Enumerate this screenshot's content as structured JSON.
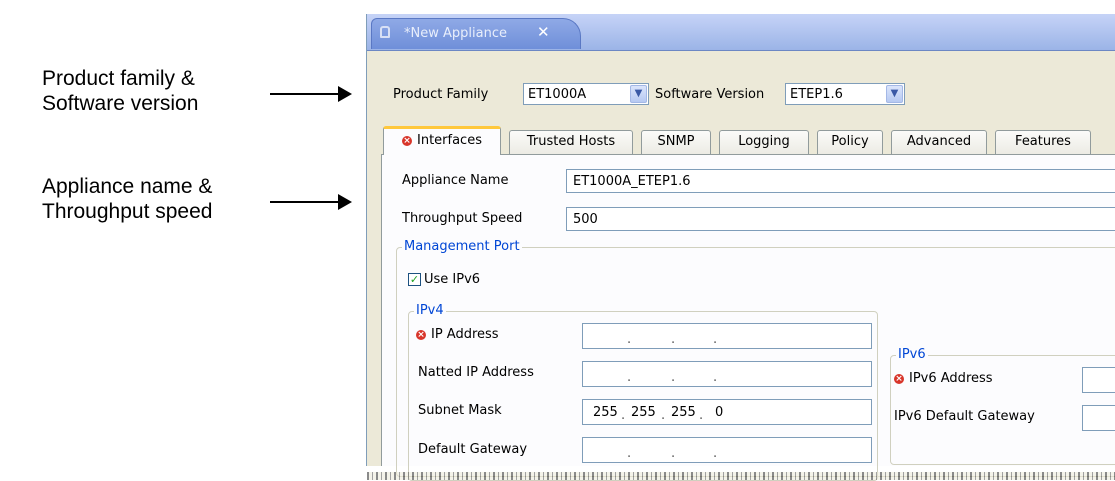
{
  "annotations": {
    "product_family_line1": "Product family &",
    "product_family_line2": "Software version",
    "appliance_line1": "Appliance name &",
    "appliance_line2": "Throughput speed"
  },
  "editor_tab": {
    "title": "*New Appliance",
    "close": "✕"
  },
  "header": {
    "product_family_label": "Product Family",
    "product_family_value": "ET1000A",
    "software_version_label": "Software Version",
    "software_version_value": "ETEP1.6"
  },
  "tabs": [
    {
      "label": "Interfaces",
      "error": true
    },
    {
      "label": "Trusted Hosts"
    },
    {
      "label": "SNMP"
    },
    {
      "label": "Logging"
    },
    {
      "label": "Policy"
    },
    {
      "label": "Advanced"
    },
    {
      "label": "Features"
    }
  ],
  "form": {
    "appliance_name_label": "Appliance Name",
    "appliance_name_value": "ET1000A_ETEP1.6",
    "throughput_label": "Throughput Speed",
    "throughput_value": "500"
  },
  "management_port": {
    "title": "Management Port",
    "use_ipv6_label": "Use IPv6",
    "use_ipv6_checked": true,
    "ipv4": {
      "title": "IPv4",
      "ip_address_label": "IP Address",
      "natted_ip_label": "Natted IP Address",
      "subnet_mask_label": "Subnet Mask",
      "subnet_mask_octets": [
        "255",
        "255",
        "255",
        "0"
      ],
      "default_gateway_label": "Default Gateway"
    },
    "ipv6": {
      "title": "IPv6",
      "address_label": "IPv6 Address",
      "gateway_label": "IPv6 Default Gateway"
    }
  },
  "colors": {
    "group_title": "#0046d5",
    "tab_highlight": "#ffc83c",
    "error": "#d8352a"
  }
}
